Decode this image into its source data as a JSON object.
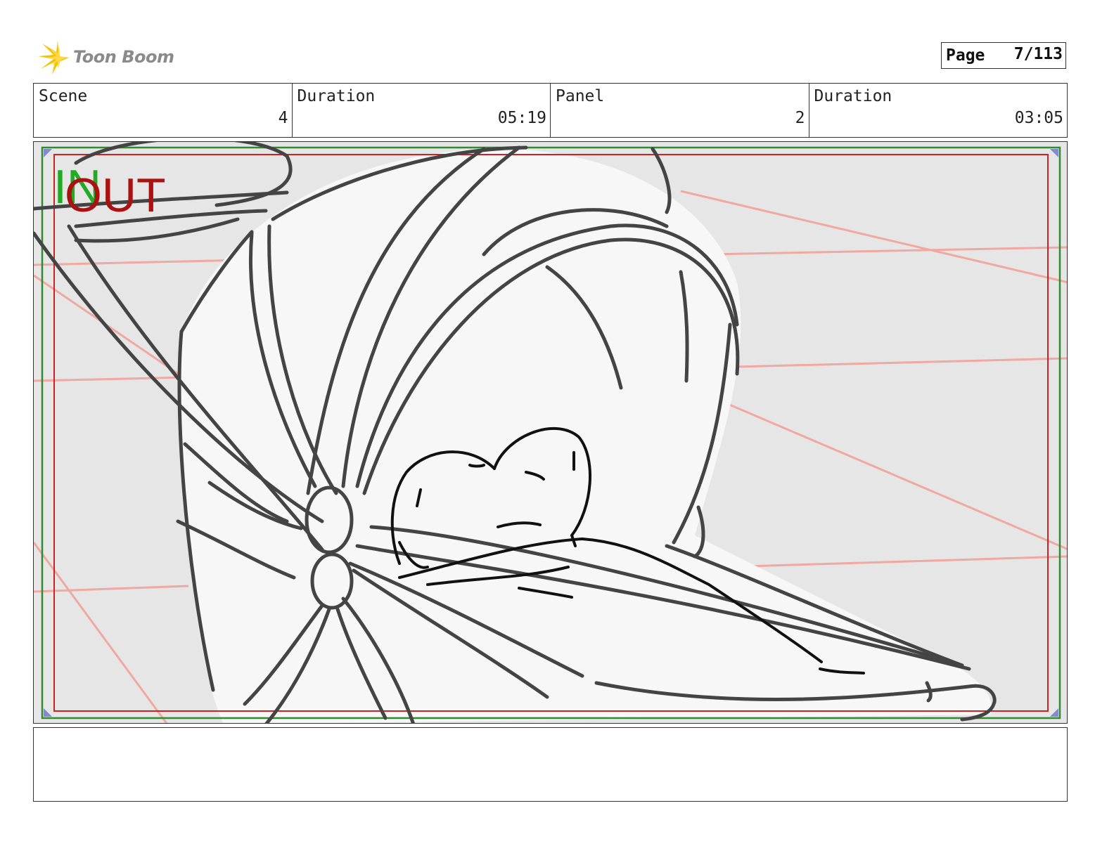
{
  "header": {
    "logo": {
      "text": "Toon Boom",
      "icon": "toon-boom-starburst-icon"
    },
    "page": {
      "label": "Page",
      "value": "7/113"
    }
  },
  "info": {
    "scene": {
      "label": "Scene",
      "value": "4"
    },
    "scene_duration": {
      "label": "Duration",
      "value": "05:19"
    },
    "panel": {
      "label": "Panel",
      "value": "2"
    },
    "panel_duration": {
      "label": "Duration",
      "value": "03:05"
    }
  },
  "panel": {
    "in_marker": "IN",
    "out_marker": "OUT",
    "colors": {
      "background": "#e6e6e6",
      "safe_frame_outer": "#2e8b2e",
      "safe_frame_inner": "#cc2222",
      "perspective_lines": "#f0a8a0",
      "sketch_stroke": "#444444"
    }
  },
  "notes": {
    "text": ""
  }
}
